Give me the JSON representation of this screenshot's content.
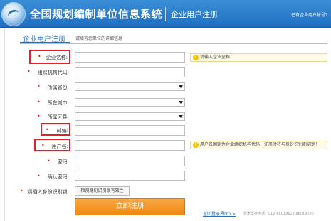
{
  "header": {
    "brand": "全国规划编制单位信息系统",
    "subtitle": "企业用户注册",
    "login_hint": "已有企业用户帐号？"
  },
  "form_header": {
    "title": "企业用户注册",
    "subtitle": "请填写您单位的详细信息"
  },
  "fields": {
    "company_name": {
      "label": "企业名称:",
      "hint": "请输入企业全称"
    },
    "org_code": {
      "label": "组织机构代码:"
    },
    "province": {
      "label": "所属省份:"
    },
    "city": {
      "label": "所在城市:"
    },
    "district": {
      "label": "所属区县:"
    },
    "postcode": {
      "label": "邮编:"
    },
    "username": {
      "label": "用户名:",
      "hint": "用户名固定为企业组织机构代码，注册时将与身份识别别绑定！"
    },
    "password": {
      "label": "密码:"
    },
    "confirm_password": {
      "label": "确认密码:"
    },
    "identity": {
      "label": "请插入身份识别锁:",
      "button": "检测身份识别锁有效性"
    }
  },
  "submit_label": "立即注册",
  "return_link": "返回登录界面>>",
  "support_text": "技术支持电话：010-88019612  88019586"
}
